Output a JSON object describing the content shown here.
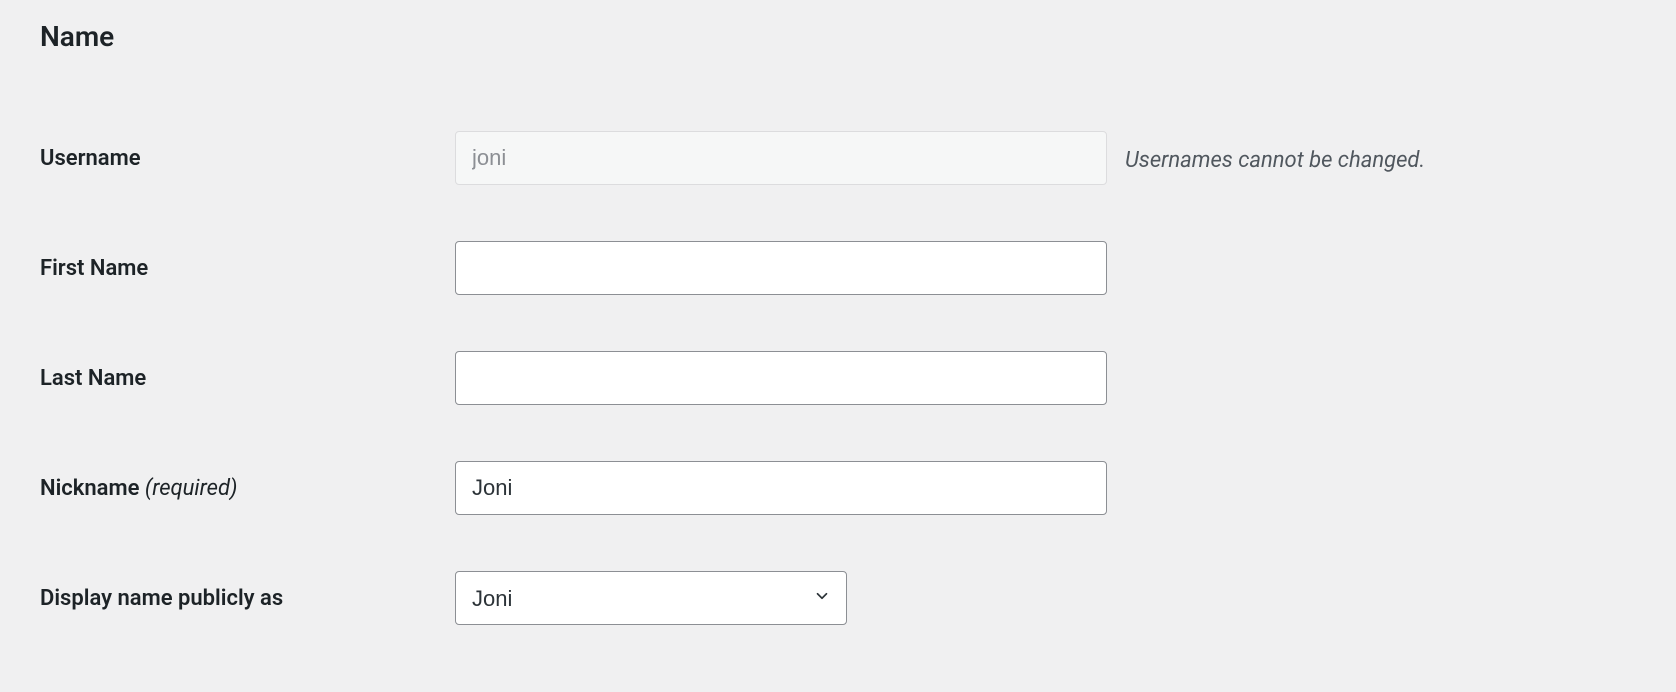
{
  "section": {
    "heading": "Name"
  },
  "fields": {
    "username": {
      "label": "Username",
      "value": "joni",
      "note": "Usernames cannot be changed."
    },
    "first_name": {
      "label": "First Name",
      "value": ""
    },
    "last_name": {
      "label": "Last Name",
      "value": ""
    },
    "nickname": {
      "label": "Nickname ",
      "required_note": "(required)",
      "value": "Joni"
    },
    "display_name": {
      "label": "Display name publicly as",
      "selected": "Joni"
    }
  }
}
